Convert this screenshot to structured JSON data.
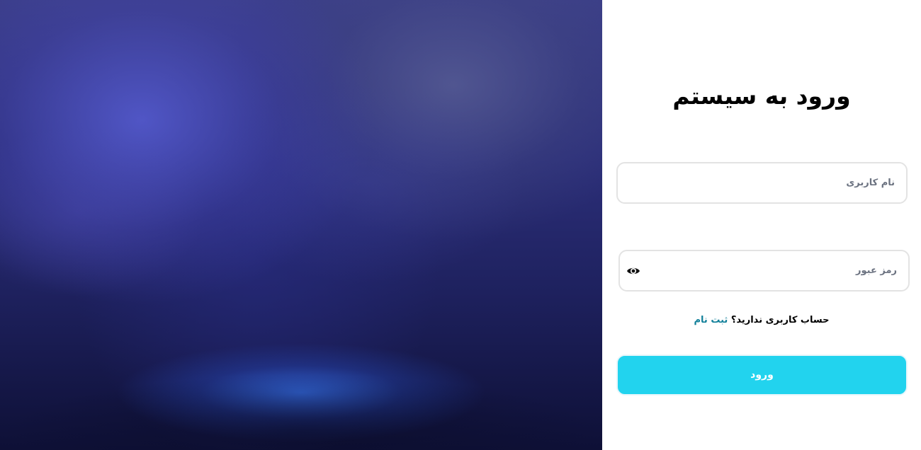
{
  "login": {
    "title": "ورود به سیستم",
    "username_placeholder": "نام کاربری",
    "password_placeholder": "رمز عبور",
    "no_account_text": "حساب کاربری ندارید؟",
    "signup_link": "ثبت نام",
    "submit_label": "ورود"
  },
  "colors": {
    "accent": "#22d3ee",
    "link": "#12809a",
    "hero_dark": "#0e1036",
    "hero_light": "#565cd2"
  },
  "icons": {
    "password_toggle": "eye-icon"
  }
}
